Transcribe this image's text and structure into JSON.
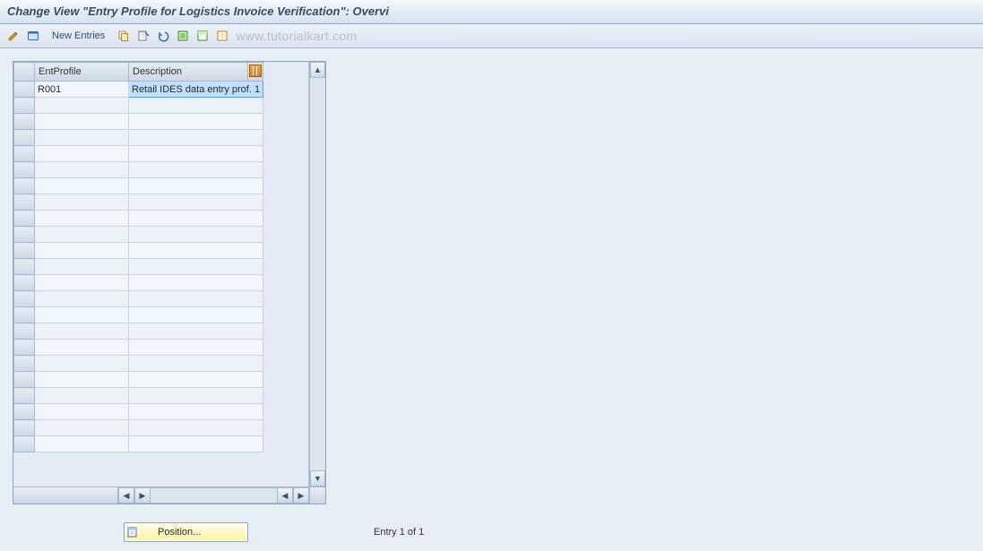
{
  "title": "Change View \"Entry Profile for Logistics Invoice Verification\": Overvi",
  "toolbar": {
    "new_entries_label": "New Entries"
  },
  "watermark": "www.tutorialkart.com",
  "table": {
    "columns": {
      "ent_profile": "EntProfile",
      "description": "Description"
    },
    "rows": [
      {
        "ent_profile": "R001",
        "description": "Retail IDES data entry prof. 1"
      }
    ],
    "blank_row_count": 22
  },
  "footer": {
    "position_label": "Position...",
    "entry_status": "Entry 1 of 1"
  }
}
